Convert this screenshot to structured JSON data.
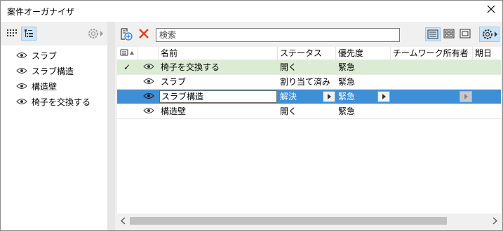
{
  "window": {
    "title": "案件オーガナイザ"
  },
  "left": {
    "tree_items": [
      {
        "label": "スラブ"
      },
      {
        "label": "スラブ構造"
      },
      {
        "label": "構造壁"
      },
      {
        "label": "椅子を交換する"
      }
    ]
  },
  "toolbar": {
    "search_placeholder": "検索"
  },
  "table": {
    "columns": {
      "name": "名前",
      "status": "ステータス",
      "priority": "優先度",
      "owner": "チームワーク所有者",
      "due": "期日"
    },
    "rows": [
      {
        "check": "✓",
        "name": "椅子を交換する",
        "status": "開く",
        "priority": "緊急"
      },
      {
        "check": "",
        "name": "スラブ",
        "status": "割り当て済み",
        "priority": "緊急"
      },
      {
        "check": "",
        "name": "スラブ構造",
        "status": "解決",
        "priority": "緊急"
      },
      {
        "check": "",
        "name": "構造壁",
        "status": "開く",
        "priority": "緊急"
      }
    ]
  },
  "colors": {
    "selected_row": "#3d8fd8",
    "checked_row": "#dcebd3",
    "delete_x": "#e3431c",
    "accent": "#2d7bd0"
  },
  "icons": [
    "close-icon",
    "grid-view-icon",
    "tree-view-icon",
    "gear-icon",
    "new-issue-icon",
    "delete-icon",
    "list-view-icon",
    "thumbnail-view-icon",
    "single-view-icon",
    "eye-icon",
    "sort-ascending-icon",
    "checkmark-icon",
    "arrow-right-icon",
    "arrow-left-icon"
  ]
}
